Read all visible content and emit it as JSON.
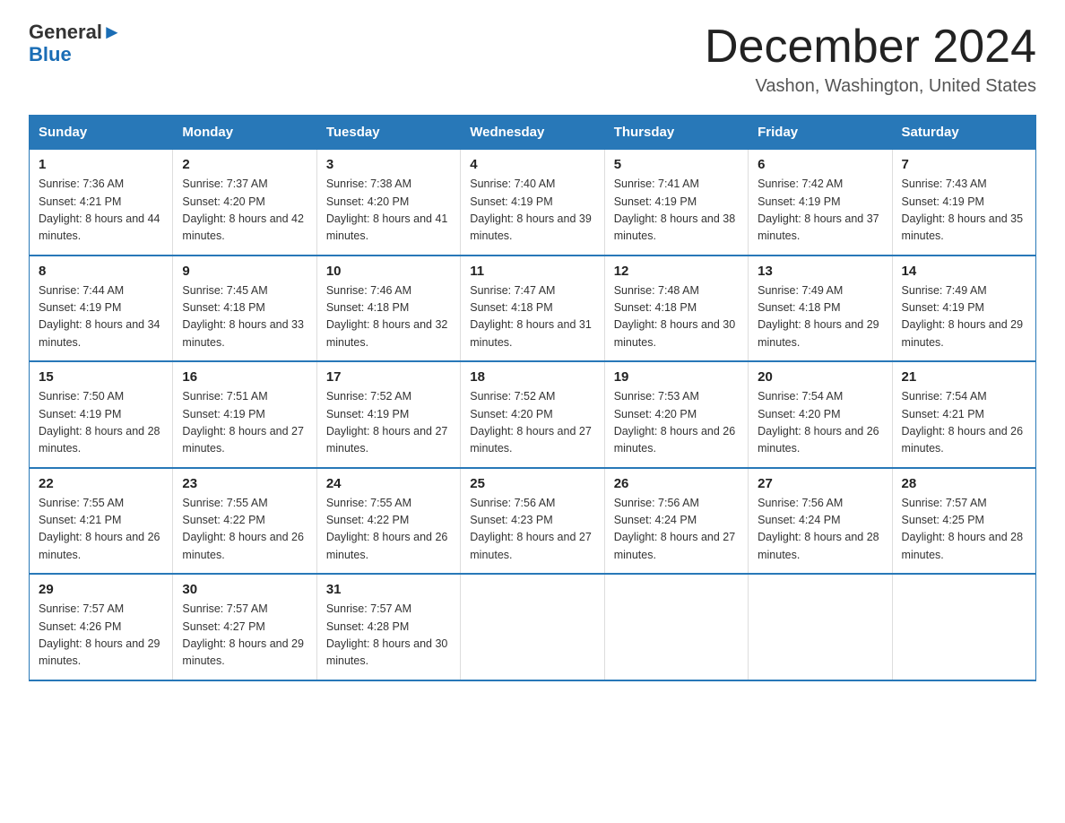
{
  "header": {
    "logo_general": "General",
    "logo_blue": "Blue",
    "month_title": "December 2024",
    "location": "Vashon, Washington, United States"
  },
  "days_of_week": [
    "Sunday",
    "Monday",
    "Tuesday",
    "Wednesday",
    "Thursday",
    "Friday",
    "Saturday"
  ],
  "weeks": [
    [
      {
        "day": "1",
        "sunrise": "7:36 AM",
        "sunset": "4:21 PM",
        "daylight": "8 hours and 44 minutes."
      },
      {
        "day": "2",
        "sunrise": "7:37 AM",
        "sunset": "4:20 PM",
        "daylight": "8 hours and 42 minutes."
      },
      {
        "day": "3",
        "sunrise": "7:38 AM",
        "sunset": "4:20 PM",
        "daylight": "8 hours and 41 minutes."
      },
      {
        "day": "4",
        "sunrise": "7:40 AM",
        "sunset": "4:19 PM",
        "daylight": "8 hours and 39 minutes."
      },
      {
        "day": "5",
        "sunrise": "7:41 AM",
        "sunset": "4:19 PM",
        "daylight": "8 hours and 38 minutes."
      },
      {
        "day": "6",
        "sunrise": "7:42 AM",
        "sunset": "4:19 PM",
        "daylight": "8 hours and 37 minutes."
      },
      {
        "day": "7",
        "sunrise": "7:43 AM",
        "sunset": "4:19 PM",
        "daylight": "8 hours and 35 minutes."
      }
    ],
    [
      {
        "day": "8",
        "sunrise": "7:44 AM",
        "sunset": "4:19 PM",
        "daylight": "8 hours and 34 minutes."
      },
      {
        "day": "9",
        "sunrise": "7:45 AM",
        "sunset": "4:18 PM",
        "daylight": "8 hours and 33 minutes."
      },
      {
        "day": "10",
        "sunrise": "7:46 AM",
        "sunset": "4:18 PM",
        "daylight": "8 hours and 32 minutes."
      },
      {
        "day": "11",
        "sunrise": "7:47 AM",
        "sunset": "4:18 PM",
        "daylight": "8 hours and 31 minutes."
      },
      {
        "day": "12",
        "sunrise": "7:48 AM",
        "sunset": "4:18 PM",
        "daylight": "8 hours and 30 minutes."
      },
      {
        "day": "13",
        "sunrise": "7:49 AM",
        "sunset": "4:18 PM",
        "daylight": "8 hours and 29 minutes."
      },
      {
        "day": "14",
        "sunrise": "7:49 AM",
        "sunset": "4:19 PM",
        "daylight": "8 hours and 29 minutes."
      }
    ],
    [
      {
        "day": "15",
        "sunrise": "7:50 AM",
        "sunset": "4:19 PM",
        "daylight": "8 hours and 28 minutes."
      },
      {
        "day": "16",
        "sunrise": "7:51 AM",
        "sunset": "4:19 PM",
        "daylight": "8 hours and 27 minutes."
      },
      {
        "day": "17",
        "sunrise": "7:52 AM",
        "sunset": "4:19 PM",
        "daylight": "8 hours and 27 minutes."
      },
      {
        "day": "18",
        "sunrise": "7:52 AM",
        "sunset": "4:20 PM",
        "daylight": "8 hours and 27 minutes."
      },
      {
        "day": "19",
        "sunrise": "7:53 AM",
        "sunset": "4:20 PM",
        "daylight": "8 hours and 26 minutes."
      },
      {
        "day": "20",
        "sunrise": "7:54 AM",
        "sunset": "4:20 PM",
        "daylight": "8 hours and 26 minutes."
      },
      {
        "day": "21",
        "sunrise": "7:54 AM",
        "sunset": "4:21 PM",
        "daylight": "8 hours and 26 minutes."
      }
    ],
    [
      {
        "day": "22",
        "sunrise": "7:55 AM",
        "sunset": "4:21 PM",
        "daylight": "8 hours and 26 minutes."
      },
      {
        "day": "23",
        "sunrise": "7:55 AM",
        "sunset": "4:22 PM",
        "daylight": "8 hours and 26 minutes."
      },
      {
        "day": "24",
        "sunrise": "7:55 AM",
        "sunset": "4:22 PM",
        "daylight": "8 hours and 26 minutes."
      },
      {
        "day": "25",
        "sunrise": "7:56 AM",
        "sunset": "4:23 PM",
        "daylight": "8 hours and 27 minutes."
      },
      {
        "day": "26",
        "sunrise": "7:56 AM",
        "sunset": "4:24 PM",
        "daylight": "8 hours and 27 minutes."
      },
      {
        "day": "27",
        "sunrise": "7:56 AM",
        "sunset": "4:24 PM",
        "daylight": "8 hours and 28 minutes."
      },
      {
        "day": "28",
        "sunrise": "7:57 AM",
        "sunset": "4:25 PM",
        "daylight": "8 hours and 28 minutes."
      }
    ],
    [
      {
        "day": "29",
        "sunrise": "7:57 AM",
        "sunset": "4:26 PM",
        "daylight": "8 hours and 29 minutes."
      },
      {
        "day": "30",
        "sunrise": "7:57 AM",
        "sunset": "4:27 PM",
        "daylight": "8 hours and 29 minutes."
      },
      {
        "day": "31",
        "sunrise": "7:57 AM",
        "sunset": "4:28 PM",
        "daylight": "8 hours and 30 minutes."
      },
      null,
      null,
      null,
      null
    ]
  ],
  "labels": {
    "sunrise": "Sunrise: ",
    "sunset": "Sunset: ",
    "daylight": "Daylight: "
  }
}
